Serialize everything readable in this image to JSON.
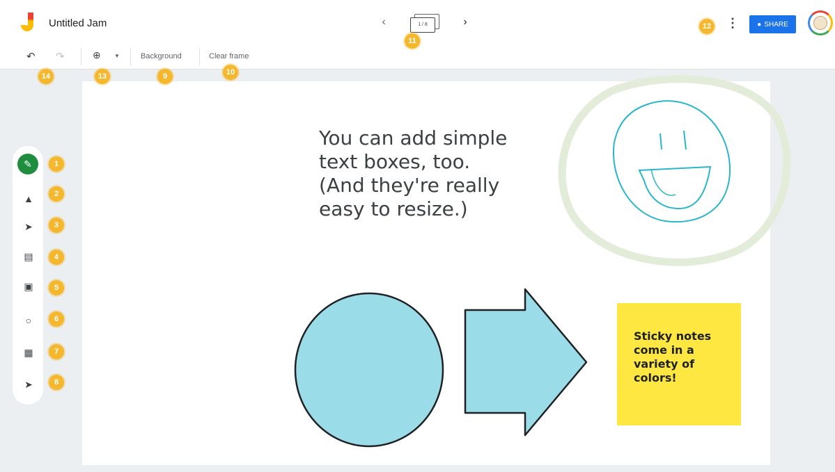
{
  "header": {
    "title": "Untitled Jam",
    "frame_indicator": "1 / 8",
    "share_label": "SHARE",
    "brand_color": "#fbbc04",
    "share_color": "#1a73e8"
  },
  "toolbar": {
    "background_label": "Background",
    "clear_frame_label": "Clear frame"
  },
  "tools": [
    {
      "name": "pen",
      "icon": "pen-icon"
    },
    {
      "name": "eraser",
      "icon": "eraser-icon"
    },
    {
      "name": "select",
      "icon": "select-arrow-icon"
    },
    {
      "name": "sticky-note",
      "icon": "sticky-note-icon"
    },
    {
      "name": "image",
      "icon": "image-icon"
    },
    {
      "name": "shapes",
      "icon": "circle-shape-icon"
    },
    {
      "name": "text-box",
      "icon": "text-box-icon"
    },
    {
      "name": "laser",
      "icon": "laser-icon"
    }
  ],
  "badges": {
    "b1": "1",
    "b2": "2",
    "b3": "3",
    "b4": "4",
    "b5": "5",
    "b6": "6",
    "b7": "7",
    "b8": "8",
    "b9": "9",
    "b10": "10",
    "b11": "11",
    "b12": "12",
    "b13": "13",
    "b14": "14"
  },
  "canvas": {
    "text_box": "You can add simple\ntext boxes, too.\n(And they're really\neasy to resize.)",
    "sticky_note": "Sticky notes\ncome in a\nvariety of\ncolors!",
    "sticky_color": "#fde740",
    "shape_fill": "#9adce8",
    "drawing_stroke": "#29b6c8",
    "highlight_stroke": "#e3ecd9"
  }
}
